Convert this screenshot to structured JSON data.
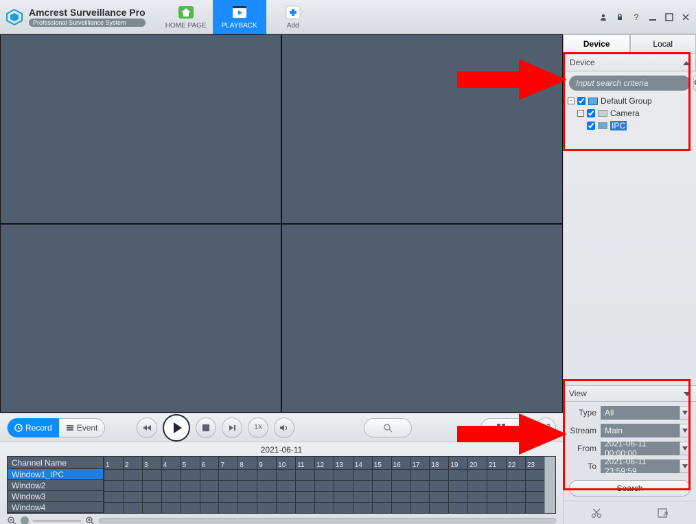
{
  "app": {
    "title": "Amcrest Surveillance Pro",
    "subtitle": "Professional Surveilliance System"
  },
  "nav": {
    "home": "HOME PAGE",
    "playback": "PLAYBACK",
    "add": "Add"
  },
  "sidebar": {
    "tab_device": "Device",
    "tab_local": "Local",
    "panel_title": "Device",
    "search_placeholder": "Input search criteria",
    "tree": {
      "root": "Default Group",
      "camera": "Camera",
      "ipc": "IPC"
    },
    "view_title": "View",
    "type_label": "Type",
    "type_value": "All",
    "stream_label": "Stream",
    "stream_value": "Main",
    "from_label": "From",
    "from_value": "2021-06-11 00:00:00",
    "to_label": "To",
    "to_value": "2021-06-11 23:59:59",
    "search_btn": "Search"
  },
  "controls": {
    "record": "Record",
    "event": "Event",
    "speed": "1X"
  },
  "timeline": {
    "date": "2021-06-11",
    "header": "Channel Name",
    "rows": [
      "Window1_IPC",
      "Window2",
      "Window3",
      "Window4"
    ],
    "hours": [
      "1",
      "2",
      "3",
      "4",
      "5",
      "6",
      "7",
      "8",
      "9",
      "10",
      "11",
      "12",
      "13",
      "14",
      "15",
      "16",
      "17",
      "18",
      "19",
      "20",
      "21",
      "22",
      "23"
    ]
  }
}
